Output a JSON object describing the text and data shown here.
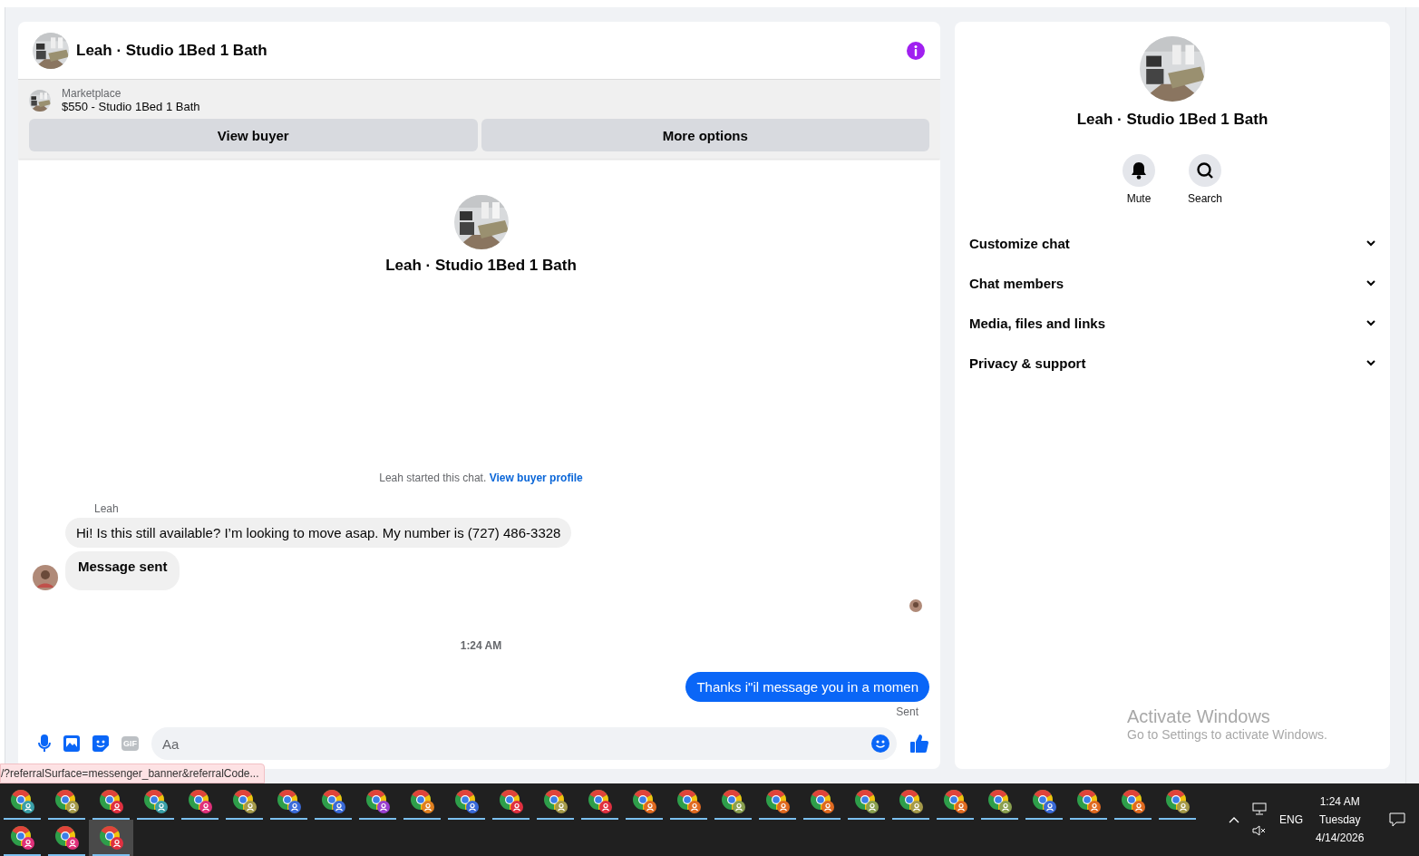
{
  "chat": {
    "title": "Leah · Studio 1Bed 1 Bath",
    "listing": {
      "source": "Marketplace",
      "title": "$550 - Studio 1Bed 1 Bath"
    },
    "actions": [
      "View buyer",
      "More options"
    ],
    "intro_name": "Leah · Studio 1Bed 1 Bath",
    "system_note": {
      "text": "Leah started this chat.",
      "link": "View buyer profile"
    },
    "incoming": {
      "sender": "Leah",
      "messages": [
        {
          "text": "Hi! Is this still available? I’m looking to move asap. My number is (727) 486-3328",
          "bold": false
        },
        {
          "text": "Message sent",
          "bold": true
        }
      ]
    },
    "timestamp": "1:24 AM",
    "outgoing": [
      {
        "text": "Thanks i\"il message you in a momen",
        "status": "Sent"
      }
    ],
    "composer": {
      "gif_label": "GIF",
      "placeholder": "Aa"
    }
  },
  "details": {
    "title": "Leah · Studio 1Bed 1 Bath",
    "actions": [
      {
        "label": "Mute",
        "kind": "bell"
      },
      {
        "label": "Search",
        "kind": "search"
      }
    ],
    "sections": [
      {
        "label": "Customize chat",
        "expanded": false
      },
      {
        "label": "Chat members",
        "expanded": false
      },
      {
        "label": "Media, files and links",
        "expanded": false
      },
      {
        "label": "Privacy & support",
        "expanded": false
      }
    ]
  },
  "status_url": "/?referralSurface=messenger_banner&referralCode...",
  "activation": {
    "title": "Activate Windows",
    "subtitle": "Go to Settings to activate Windows."
  },
  "taskbar": {
    "apps": [
      {
        "color": "#3aa0a8",
        "selected": false
      },
      {
        "color": "#a59a4a",
        "selected": false
      },
      {
        "color": "#e03040",
        "selected": false
      },
      {
        "color": "#3aa0a8",
        "selected": false
      },
      {
        "color": "#e0307a",
        "selected": false
      },
      {
        "color": "#a59a4a",
        "selected": false
      },
      {
        "color": "#3a6ad8",
        "selected": false
      },
      {
        "color": "#3a6ad8",
        "selected": false
      },
      {
        "color": "#9a40d0",
        "selected": false
      },
      {
        "color": "#e08020",
        "selected": false
      },
      {
        "color": "#3a6ad8",
        "selected": false
      },
      {
        "color": "#e03040",
        "selected": false
      },
      {
        "color": "#a59a4a",
        "selected": false
      },
      {
        "color": "#e03040",
        "selected": false
      },
      {
        "color": "#e06a20",
        "selected": false
      },
      {
        "color": "#e06a20",
        "selected": false
      },
      {
        "color": "#8aa050",
        "selected": false
      },
      {
        "color": "#e06a20",
        "selected": false
      },
      {
        "color": "#e06a20",
        "selected": false
      },
      {
        "color": "#8aa050",
        "selected": false
      },
      {
        "color": "#a59a4a",
        "selected": false
      },
      {
        "color": "#e06a20",
        "selected": false
      },
      {
        "color": "#8aa050",
        "selected": false
      },
      {
        "color": "#3a6ad8",
        "selected": false
      },
      {
        "color": "#e06a20",
        "selected": false
      },
      {
        "color": "#e06a20",
        "selected": false
      },
      {
        "color": "#a59a4a",
        "selected": false
      },
      {
        "color": "#e0307a",
        "selected": false
      },
      {
        "color": "#e0307a",
        "selected": false
      },
      {
        "color": "#e03040",
        "selected": true
      }
    ],
    "tray": {
      "language": "ENG",
      "time": "1:24 AM",
      "day": "Tuesday",
      "date": "4/14/2026"
    }
  }
}
